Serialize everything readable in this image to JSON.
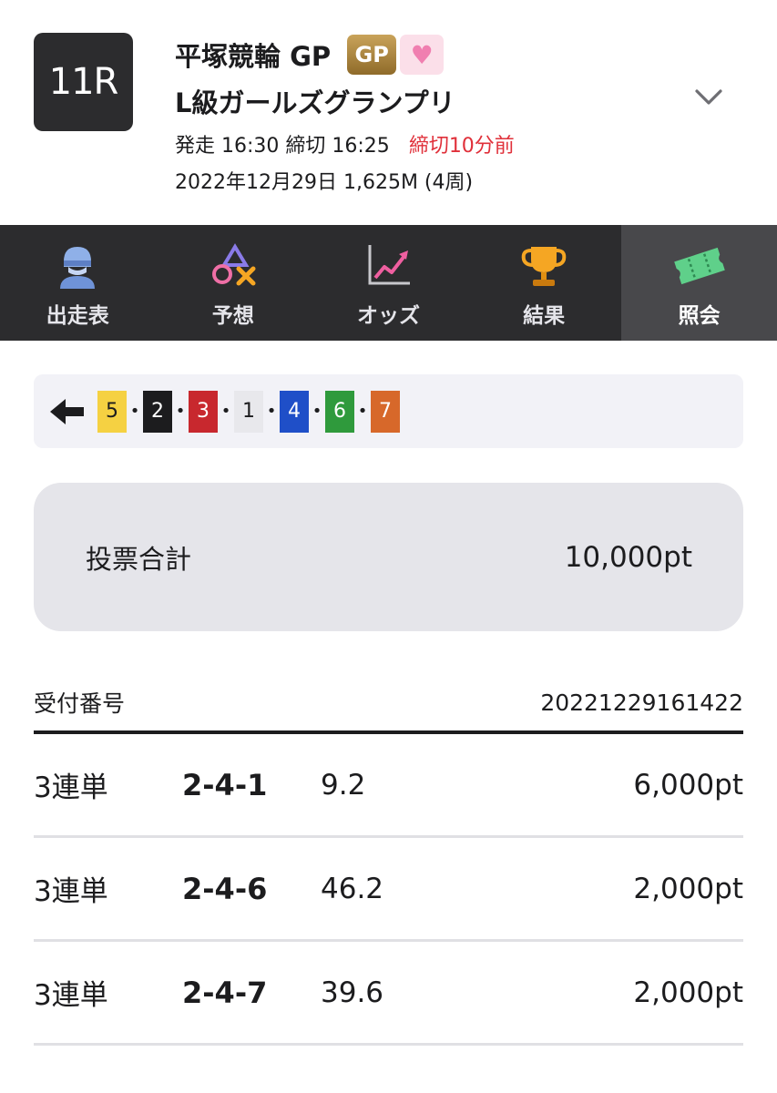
{
  "header": {
    "race_number": "11R",
    "venue": "平塚競輪 GP",
    "gp_badge": "GP",
    "race_name": "L級ガールズグランプリ",
    "start_label": "発走 16:30",
    "deadline_label": "締切 16:25",
    "deadline_alert": "締切10分前",
    "date_distance": "2022年12月29日 1,625M (4周)"
  },
  "tabs": [
    {
      "label": "出走表",
      "icon": "racer-icon"
    },
    {
      "label": "予想",
      "icon": "prediction-icon"
    },
    {
      "label": "オッズ",
      "icon": "odds-chart-icon"
    },
    {
      "label": "結果",
      "icon": "trophy-icon"
    },
    {
      "label": "照会",
      "icon": "ticket-icon",
      "active": true
    }
  ],
  "result_order": [
    {
      "number": "5",
      "bg": "#f5d142",
      "fg": "#1c1c1e"
    },
    {
      "number": "2",
      "bg": "#1c1c1e",
      "fg": "#ffffff"
    },
    {
      "number": "3",
      "bg": "#c8282e",
      "fg": "#ffffff"
    },
    {
      "number": "1",
      "bg": "#e8e8ec",
      "fg": "#1c1c1e"
    },
    {
      "number": "4",
      "bg": "#1f4fc8",
      "fg": "#ffffff"
    },
    {
      "number": "6",
      "bg": "#2f9a3c",
      "fg": "#ffffff"
    },
    {
      "number": "7",
      "bg": "#d7682a",
      "fg": "#ffffff"
    }
  ],
  "total": {
    "label": "投票合計",
    "value": "10,000pt"
  },
  "receipt": {
    "label": "受付番号",
    "number": "20221229161422"
  },
  "bets": [
    {
      "type": "3連単",
      "combo": "2-4-1",
      "odds": "9.2",
      "amount": "6,000pt"
    },
    {
      "type": "3連単",
      "combo": "2-4-6",
      "odds": "46.2",
      "amount": "2,000pt"
    },
    {
      "type": "3連単",
      "combo": "2-4-7",
      "odds": "39.6",
      "amount": "2,000pt"
    }
  ]
}
